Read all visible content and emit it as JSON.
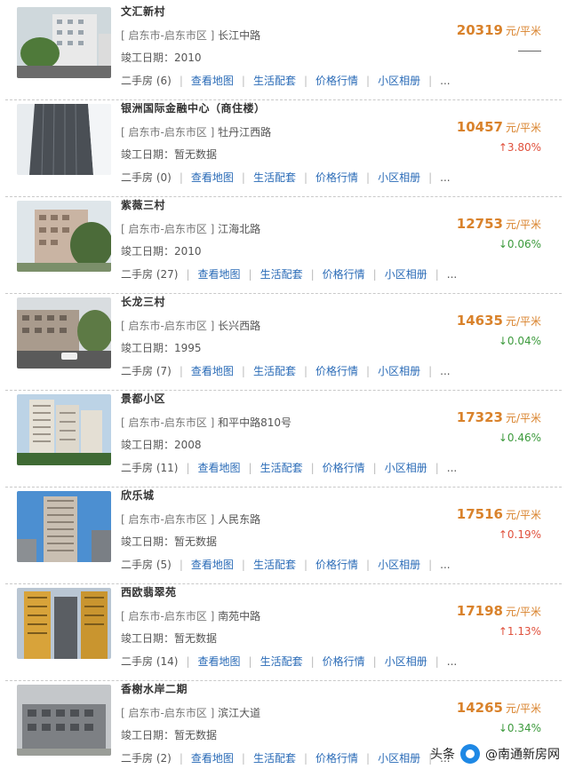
{
  "listings": [
    {
      "name": "文汇新村",
      "address_district": "[ 启东市-启东市区 ]",
      "address_street": "长江中路",
      "completion": "竣工日期：2010",
      "resale_label": "二手房",
      "resale_count": "(6)",
      "price": "20319",
      "price_unit": "元/平米",
      "change": "",
      "change_dir": "flat"
    },
    {
      "name": "银洲国际金融中心（商住楼）",
      "address_district": "[ 启东市-启东市区 ]",
      "address_street": "牡丹江西路",
      "completion": "竣工日期：暂无数据",
      "resale_label": "二手房",
      "resale_count": "(0)",
      "price": "10457",
      "price_unit": "元/平米",
      "change": "↑3.80%",
      "change_dir": "up"
    },
    {
      "name": "紫薇三村",
      "address_district": "[ 启东市-启东市区 ]",
      "address_street": "江海北路",
      "completion": "竣工日期：2010",
      "resale_label": "二手房",
      "resale_count": "(27)",
      "price": "12753",
      "price_unit": "元/平米",
      "change": "↓0.06%",
      "change_dir": "down"
    },
    {
      "name": "长龙三村",
      "address_district": "[ 启东市-启东市区 ]",
      "address_street": "长兴西路",
      "completion": "竣工日期：1995",
      "resale_label": "二手房",
      "resale_count": "(7)",
      "price": "14635",
      "price_unit": "元/平米",
      "change": "↓0.04%",
      "change_dir": "down"
    },
    {
      "name": "景都小区",
      "address_district": "[ 启东市-启东市区 ]",
      "address_street": "和平中路810号",
      "completion": "竣工日期：2008",
      "resale_label": "二手房",
      "resale_count": "(11)",
      "price": "17323",
      "price_unit": "元/平米",
      "change": "↓0.46%",
      "change_dir": "down"
    },
    {
      "name": "欣乐城",
      "address_district": "[ 启东市-启东市区 ]",
      "address_street": "人民东路",
      "completion": "竣工日期：暂无数据",
      "resale_label": "二手房",
      "resale_count": "(5)",
      "price": "17516",
      "price_unit": "元/平米",
      "change": "↑0.19%",
      "change_dir": "up"
    },
    {
      "name": "西欧翡翠苑",
      "address_district": "[ 启东市-启东市区 ]",
      "address_street": "南苑中路",
      "completion": "竣工日期：暂无数据",
      "resale_label": "二手房",
      "resale_count": "(14)",
      "price": "17198",
      "price_unit": "元/平米",
      "change": "↑1.13%",
      "change_dir": "up"
    },
    {
      "name": "香榭水岸二期",
      "address_district": "[ 启东市-启东市区 ]",
      "address_street": "滨江大道",
      "completion": "竣工日期：暂无数据",
      "resale_label": "二手房",
      "resale_count": "(2)",
      "price": "14265",
      "price_unit": "元/平米",
      "change": "↓0.34%",
      "change_dir": "down"
    }
  ],
  "links": {
    "map": "查看地图",
    "amenities": "生活配套",
    "price_trend": "价格行情",
    "album": "小区相册",
    "more": "..."
  },
  "watermark": {
    "prefix": "头条",
    "account": "@南通新房网"
  },
  "colors": {
    "price": "#d9822b",
    "up": "#e0503c",
    "down": "#3c9a3c",
    "link": "#2a6bb7"
  }
}
